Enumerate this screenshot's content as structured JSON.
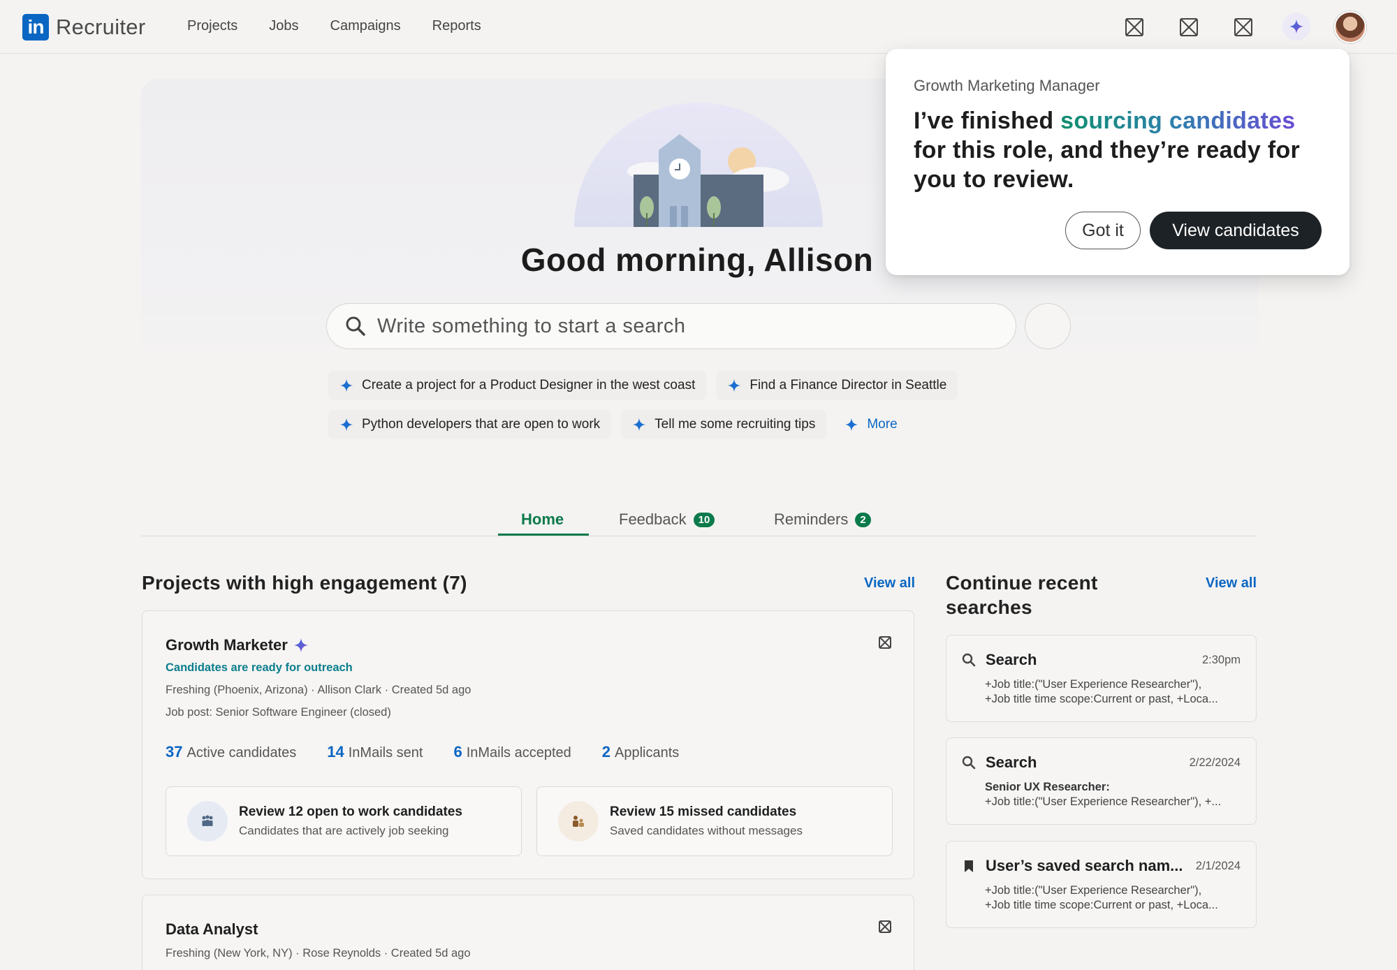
{
  "app": {
    "logo_mark": "in",
    "logo_text": "Recruiter"
  },
  "nav": {
    "links": [
      "Projects",
      "Jobs",
      "Campaigns",
      "Reports"
    ],
    "icons": [
      "placeholder-icon",
      "placeholder-icon",
      "placeholder-icon",
      "sparkle-icon",
      "avatar"
    ]
  },
  "hero": {
    "greeting": "Good morning, Allison",
    "search_placeholder": "Write something to start a search",
    "suggestions_row1": [
      "Create a project for a Product Designer in the west coast",
      "Find a Finance Director in Seattle"
    ],
    "suggestions_row2": [
      "Python developers that are open to work",
      "Tell me some recruiting tips"
    ],
    "more_label": "More"
  },
  "tabs": [
    {
      "label": "Home",
      "badge": null
    },
    {
      "label": "Feedback",
      "badge": "10"
    },
    {
      "label": "Reminders",
      "badge": "2"
    }
  ],
  "projects": {
    "title": "Projects with high engagement (7)",
    "view_all": "View all",
    "items": [
      {
        "title": "Growth Marketer",
        "status": "Candidates are ready for outreach",
        "meta1": "Freshing (Phoenix, Arizona) · Allison Clark · Created 5d ago",
        "meta2": "Job post: Senior Software Engineer (closed)",
        "stats": [
          {
            "num": "37",
            "label": "Active candidates"
          },
          {
            "num": "14",
            "label": "InMails sent"
          },
          {
            "num": "6",
            "label": "InMails accepted"
          },
          {
            "num": "2",
            "label": "Applicants"
          }
        ],
        "actions": [
          {
            "title": "Review 12 open to work candidates",
            "desc": "Candidates that are actively job seeking"
          },
          {
            "title": "Review 15 missed candidates",
            "desc": "Saved candidates without messages"
          }
        ]
      },
      {
        "title": "Data Analyst",
        "meta1": "Freshing (New York, NY) · Rose Reynolds · Created 5d ago"
      }
    ]
  },
  "recent": {
    "title": "Continue recent searches",
    "view_all": "View all",
    "items": [
      {
        "type": "Search",
        "time": "2:30pm",
        "lines": [
          "+Job title:(\"User Experience Researcher\"),",
          "+Job title time scope:Current or past, +Loca..."
        ]
      },
      {
        "type": "Search",
        "time": "2/22/2024",
        "lines": [
          "Senior UX Researcher:",
          "+Job title:(\"User Experience Researcher\"), +..."
        ]
      },
      {
        "type": "User’s saved search nam...",
        "time": "2/1/2024",
        "lines": [
          "+Job title:(\"User Experience Researcher\"),",
          "+Job title time scope:Current or past, +Loca..."
        ]
      }
    ]
  },
  "popover": {
    "subtitle": "Growth Marketing Manager",
    "head_pre": "I’ve finished ",
    "head_highlight": "sourcing candidates",
    "head_post": " for this role, and they’re ready for you to review.",
    "btn_secondary": "Got it",
    "btn_primary": "View candidates"
  },
  "colors": {
    "accent_blue": "#0a66c2",
    "accent_green": "#0b7a4b",
    "status_teal": "#0b7e8c"
  }
}
